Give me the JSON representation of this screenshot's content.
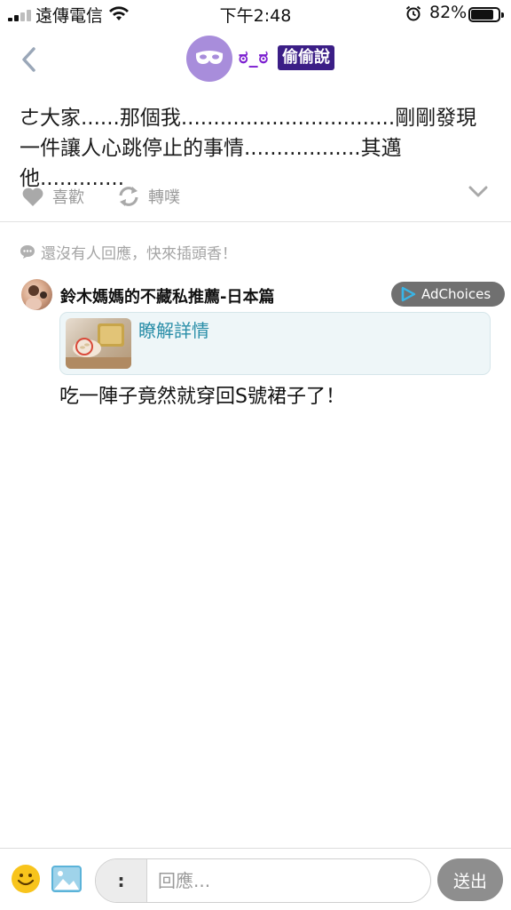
{
  "status_bar": {
    "carrier": "遠傳電信",
    "time": "下午2:48",
    "battery": "82%",
    "battery_level": 0.82
  },
  "header": {
    "nickname": "ಠ_ಠ",
    "board": "偷偷說"
  },
  "post": {
    "content": "ㄜ大家......那個我.................................剛剛發現一件讓人心跳停止的事情..................其邁他.............",
    "like_label": "喜歡",
    "share_label": "轉噗"
  },
  "replies": {
    "empty_text": "還沒有人回應，快來插頭香！"
  },
  "ad": {
    "author": "鈴木媽媽的不藏私推薦-日本篇",
    "adchoices_label": "AdChoices",
    "cta": "瞭解詳情",
    "headline": "吃一陣子竟然就穿回S號裙子了！"
  },
  "composer": {
    "prefix": ":",
    "placeholder": "回應...",
    "send_label": "送出"
  },
  "colors": {
    "brand_purple": "#3b1e86",
    "nickname_purple": "#7c1fd0",
    "link_teal": "#2a8ea8"
  },
  "icons": [
    "back-chevron-icon",
    "heart-icon",
    "replurk-icon",
    "chevron-down-icon",
    "comment-bubble-icon",
    "adchoices-icon",
    "emoji-icon",
    "image-icon",
    "wifi-icon",
    "alarm-icon"
  ]
}
